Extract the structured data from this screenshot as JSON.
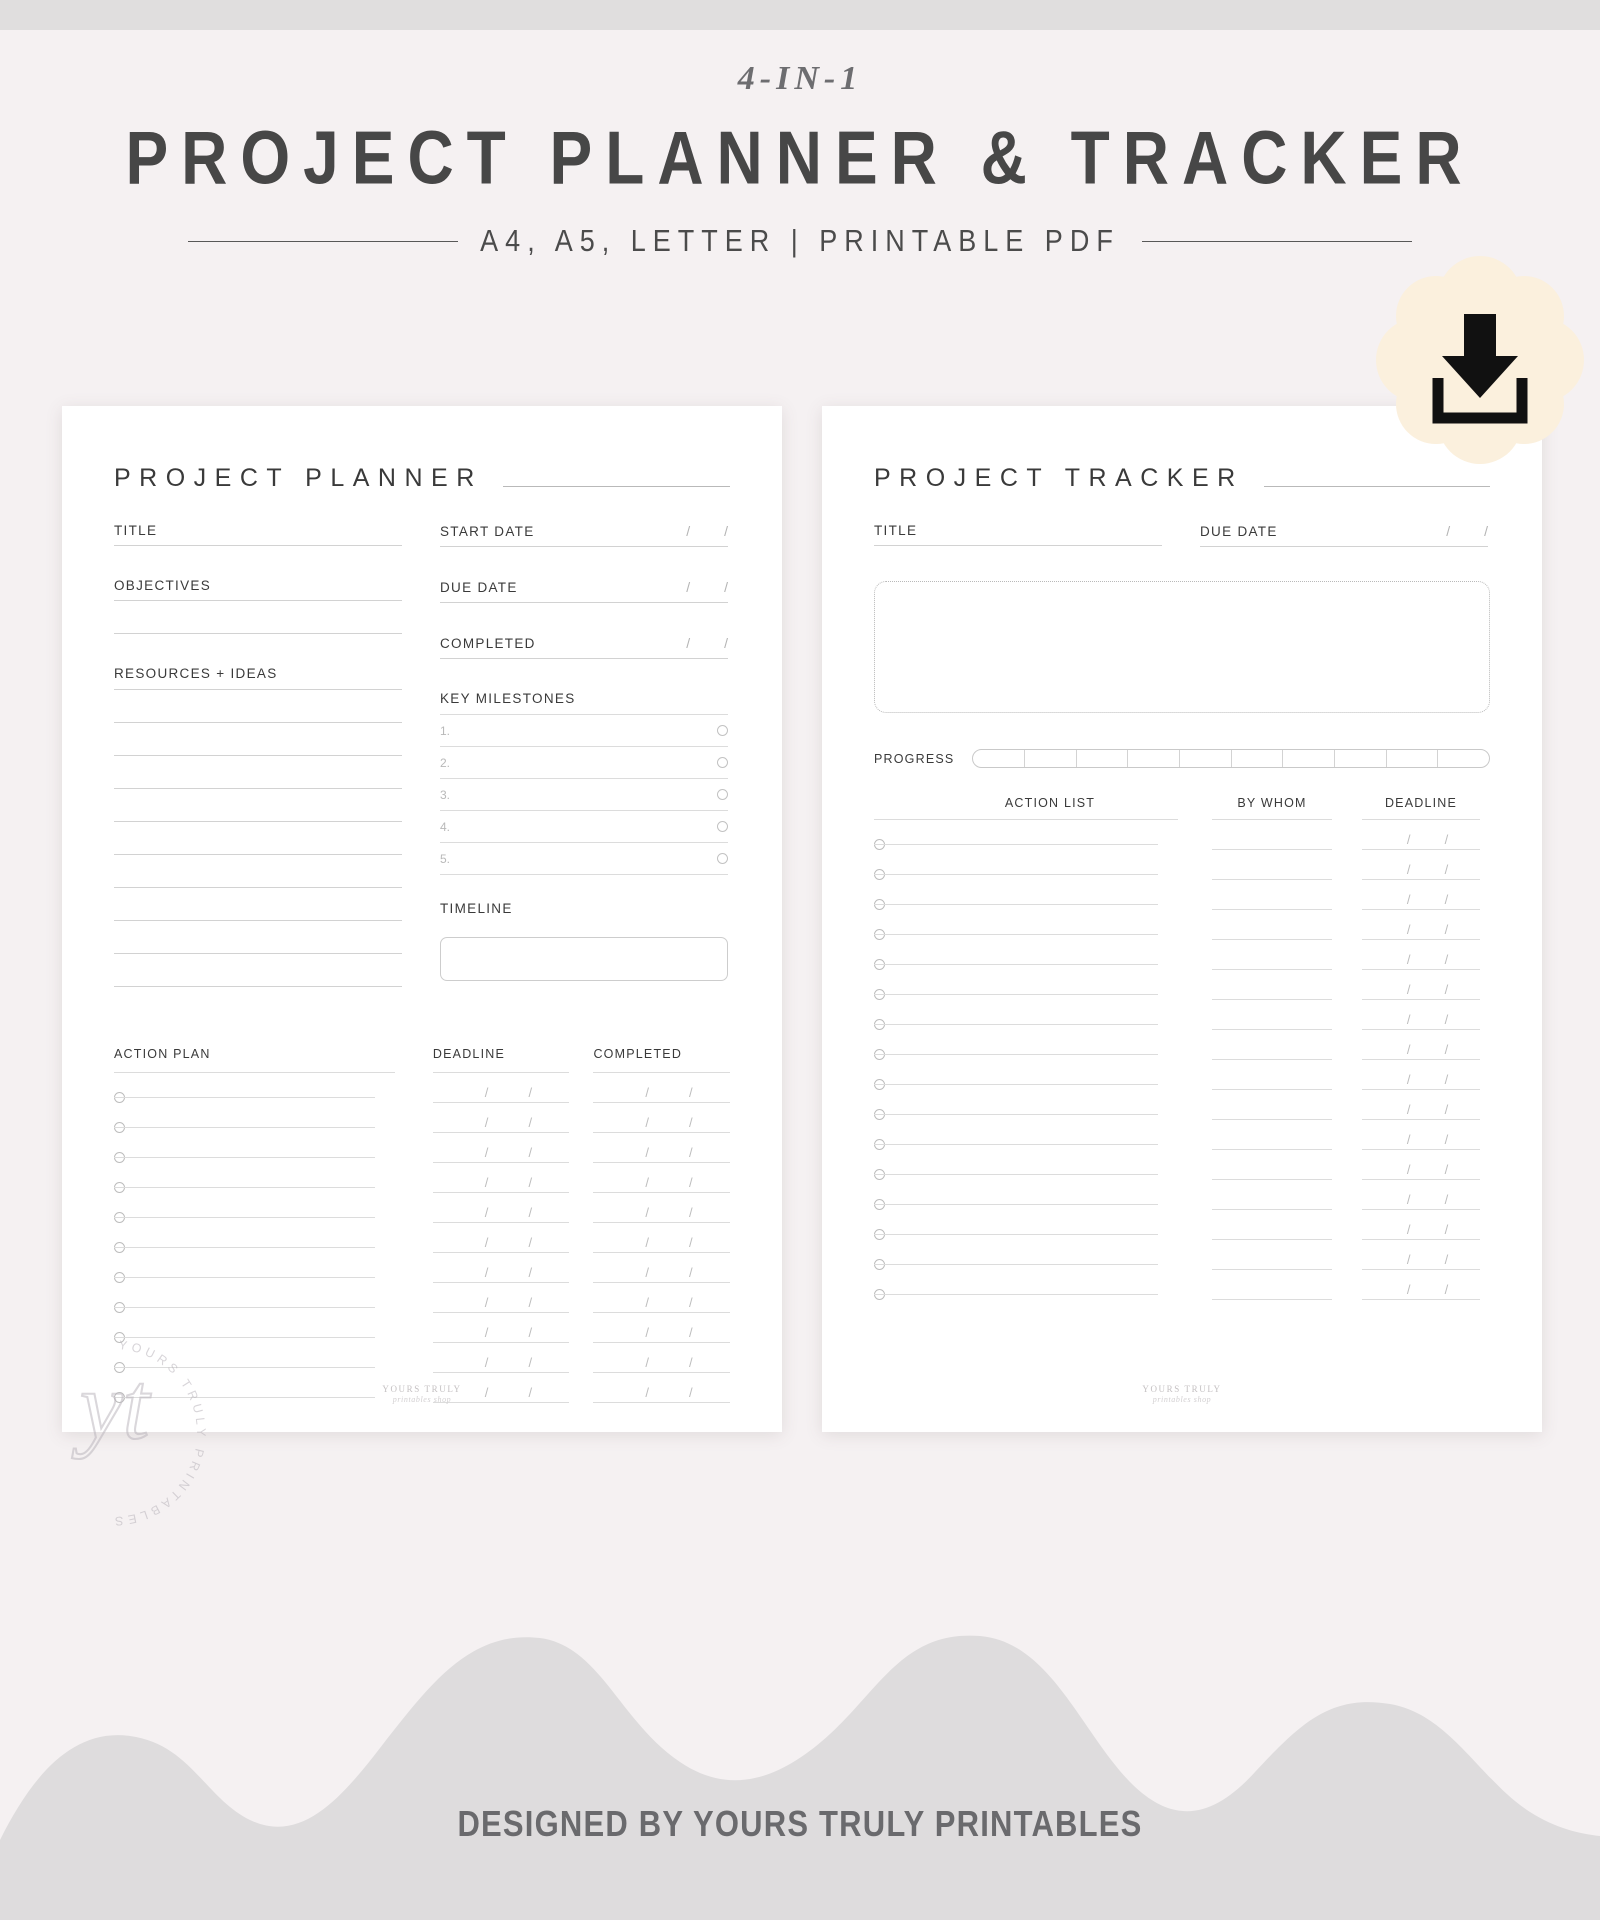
{
  "header": {
    "kicker": "4-IN-1",
    "title": "PROJECT PLANNER & TRACKER",
    "subtitle": "A4, A5, LETTER | PRINTABLE PDF"
  },
  "badge": {
    "icon": "download-icon"
  },
  "planner": {
    "heading": "PROJECT PLANNER",
    "left_column": {
      "title_label": "TITLE",
      "objectives_label": "OBJECTIVES",
      "objectives_lines": 2,
      "resources_label": "RESOURCES + IDEAS",
      "resources_lines": 10
    },
    "right_column": {
      "start_date_label": "START DATE",
      "due_date_label": "DUE DATE",
      "completed_label": "COMPLETED",
      "date_separator": "/",
      "milestones_label": "KEY MILESTONES",
      "milestones": [
        "1.",
        "2.",
        "3.",
        "4.",
        "5."
      ],
      "timeline_label": "TIMELINE"
    },
    "action_plan": {
      "col1": "ACTION PLAN",
      "col2": "DEADLINE",
      "col3": "COMPLETED",
      "rows": 11
    },
    "footer_logo": {
      "line1": "YOURS TRULY",
      "line2": "printables shop"
    }
  },
  "tracker": {
    "heading": "PROJECT TRACKER",
    "title_label": "TITLE",
    "due_date_label": "DUE DATE",
    "date_separator": "/",
    "notes_box": "dotted-notes-area",
    "progress_label": "PROGRESS",
    "progress_segments": 10,
    "table": {
      "col1": "ACTION LIST",
      "col2": "BY WHOM",
      "col3": "DEADLINE",
      "rows": 16
    },
    "footer_logo": {
      "line1": "YOURS TRULY",
      "line2": "printables shop"
    }
  },
  "watermark": {
    "monogram": "yt",
    "ring_text": "YOURS TRULY PRINTABLES"
  },
  "footer": {
    "caption": "DESIGNED BY YOURS TRULY PRINTABLES"
  },
  "colors": {
    "background": "#f5f1f2",
    "sheet": "#ffffff",
    "ink": "#3a3a3a",
    "rule": "#cfcfcf",
    "badge": "#fbf0dd",
    "wave": "#dedcdd",
    "caption": "#6a6a6d"
  }
}
